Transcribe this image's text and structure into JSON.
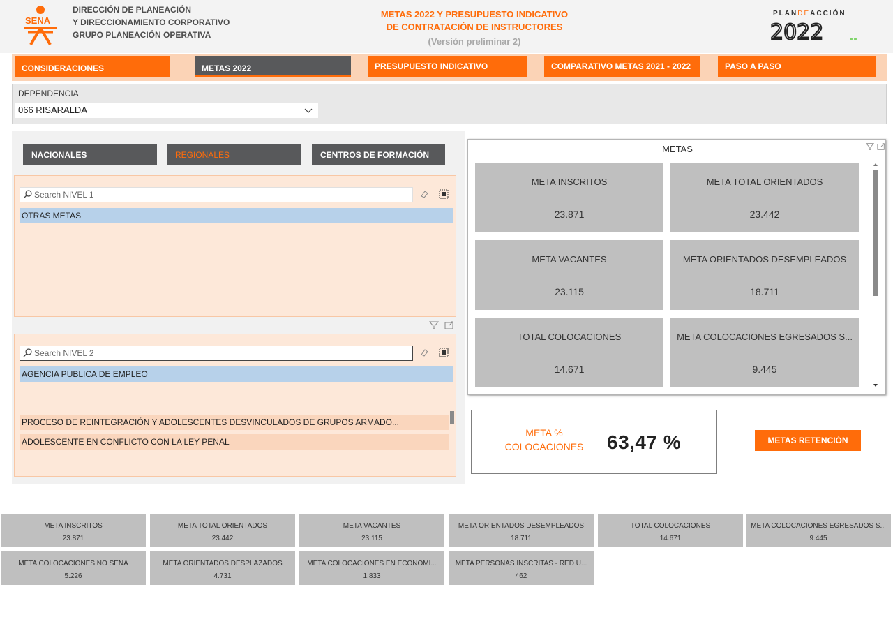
{
  "header": {
    "logo_text": "SENA",
    "org_line1": "DIRECCIÓN DE PLANEACIÓN",
    "org_line2": "Y DIRECCIONAMIENTO CORPORATIVO",
    "org_line3": "GRUPO PLANEACIÓN OPERATIVA",
    "title_line1": "METAS 2022 Y PRESUPUESTO INDICATIVO",
    "title_line2": "DE CONTRATACIÓN DE INSTRUCTORES",
    "subtitle": "(Versión preliminar 2)",
    "plan_logo_a": "PLAN",
    "plan_logo_b": "DE",
    "plan_logo_c": "ACCIÓN",
    "plan_logo_year": "2022"
  },
  "nav": {
    "items": [
      {
        "label": "CONSIDERACIONES"
      },
      {
        "label": "METAS 2022"
      },
      {
        "label": "PRESUPUESTO INDICATIVO"
      },
      {
        "label": "COMPARATIVO METAS 2021 - 2022"
      },
      {
        "label": "PASO A PASO"
      }
    ],
    "active": "METAS 2022"
  },
  "dependencia": {
    "label": "DEPENDENCIA",
    "value": "066 RISARALDA"
  },
  "tabs": {
    "nacionales": "NACIONALES",
    "regionales": "REGIONALES",
    "centros": "CENTROS DE FORMACIÓN"
  },
  "slicer1": {
    "placeholder": "Search NIVEL 1",
    "items": [
      "OTRAS METAS"
    ]
  },
  "slicer2": {
    "placeholder": "Search NIVEL 2",
    "items": [
      "AGENCIA PUBLICA DE EMPLEO",
      "PROCESO DE REINTEGRACIÓN Y ADOLESCENTES DESVINCULADOS DE GRUPOS ARMADO...",
      "ADOLESCENTE EN CONFLICTO CON LA LEY PENAL"
    ]
  },
  "metas_panel": {
    "title": "METAS",
    "cards": [
      {
        "label": "META INSCRITOS",
        "value": "23.871"
      },
      {
        "label": "META TOTAL ORIENTADOS",
        "value": "23.442"
      },
      {
        "label": "META VACANTES",
        "value": "23.115"
      },
      {
        "label": "META ORIENTADOS DESEMPLEADOS",
        "value": "18.711"
      },
      {
        "label": "TOTAL COLOCACIONES",
        "value": "14.671"
      },
      {
        "label": "META COLOCACIONES EGRESADOS S...",
        "value": "9.445"
      }
    ]
  },
  "meta_pct": {
    "label_line1": "META %",
    "label_line2": "COLOCACIONES",
    "value": "63,47 %"
  },
  "retencion_button": "METAS RETENCIÓN",
  "bottom_cards": [
    {
      "label": "META INSCRITOS",
      "value": "23.871"
    },
    {
      "label": "META TOTAL ORIENTADOS",
      "value": "23.442"
    },
    {
      "label": "META VACANTES",
      "value": "23.115"
    },
    {
      "label": "META ORIENTADOS DESEMPLEADOS",
      "value": "18.711"
    },
    {
      "label": "TOTAL COLOCACIONES",
      "value": "14.671"
    },
    {
      "label": "META COLOCACIONES EGRESADOS S...",
      "value": "9.445"
    },
    {
      "label": "META COLOCACIONES NO SENA",
      "value": "5.226"
    },
    {
      "label": "META ORIENTADOS DESPLAZADOS",
      "value": "4.731"
    },
    {
      "label": "META COLOCACIONES EN ECONOMI...",
      "value": "1.833"
    },
    {
      "label": "META PERSONAS INSCRITAS - RED U...",
      "value": "462"
    }
  ],
  "colors": {
    "accent": "#ff6c0a",
    "dark_button": "#58595b",
    "card_gray": "#bfbfbf",
    "selected_item": "#b7d1ea",
    "slicer_bg": "#fde8d9"
  },
  "icons": {
    "search": "search-icon",
    "erase": "eraser-icon",
    "select_all": "select-all-icon",
    "filter": "filter-icon",
    "focus": "focus-mode-icon",
    "dropdown": "chevron-down-icon"
  }
}
